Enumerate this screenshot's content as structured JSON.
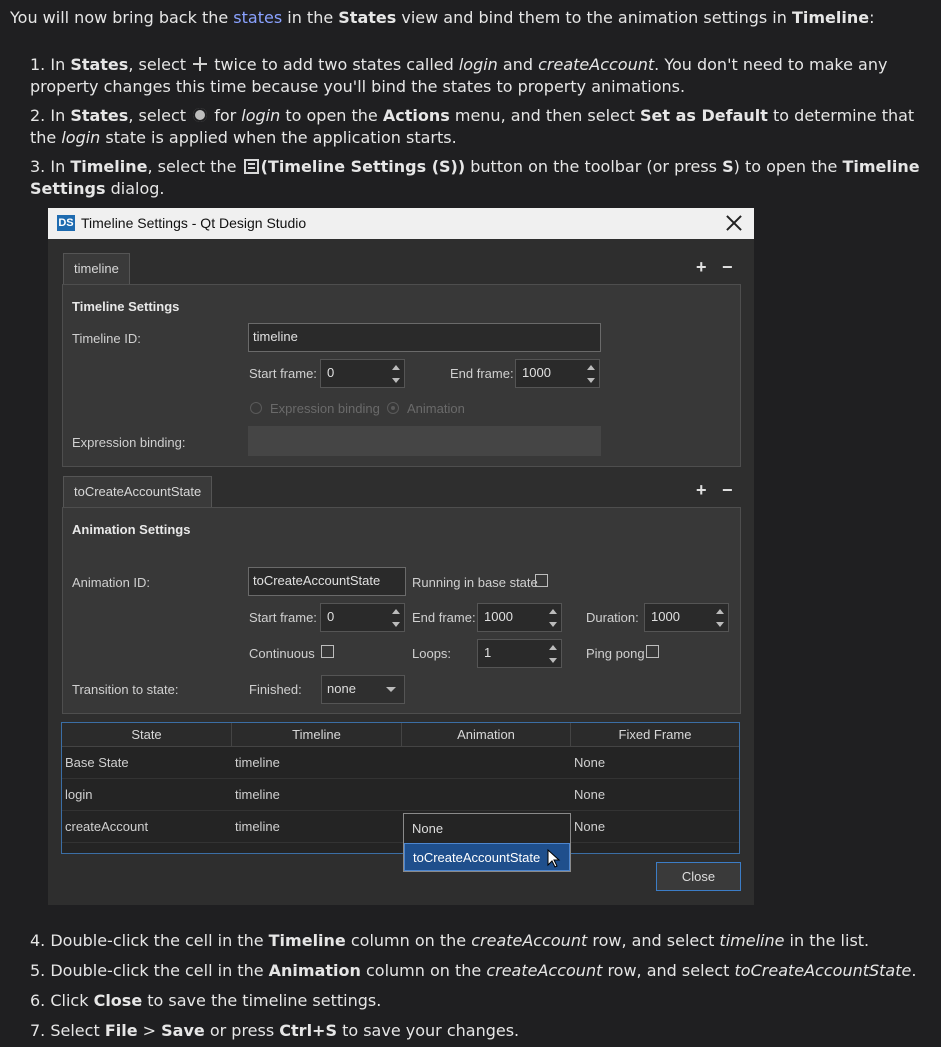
{
  "intro": {
    "t1": "You will now bring back the ",
    "link": "states",
    "t2": " in the ",
    "b1": "States",
    "t3": " view and bind them to the animation settings in ",
    "b2": "Timeline",
    "t4": ":"
  },
  "step1": {
    "n": "1.",
    "a": "In ",
    "b1": "States",
    ",": "",
    "c": ", select ",
    "d": " twice to add two states called ",
    "i1": "login",
    "e": " and ",
    "i2": "createAccount",
    "f": ". You don't need to make any property changes this time because you'll bind the states to property animations."
  },
  "step2": {
    "n": "2.",
    "a": "In ",
    "b1": "States",
    "c": ", select ",
    "d": " for ",
    "i1": "login",
    "e": " to open the ",
    "b2": "Actions",
    "f": " menu, and then select ",
    "b3": "Set as Default",
    "g": " to determine that the ",
    "i2": "login",
    "h": " state is applied when the application starts."
  },
  "step3": {
    "n": "3.",
    "a": "In ",
    "b1": "Timeline",
    "c": ", select the ",
    "b2": "(Timeline Settings (S))",
    "d": " button on the toolbar (or press ",
    "b3": "S",
    "e": ") to open the ",
    "b4": "Timeline Settings",
    "f": " dialog."
  },
  "dialog": {
    "logo": "DS",
    "title": "Timeline Settings - Qt Design Studio",
    "timeline_tab": "timeline",
    "timeline_section": "Timeline Settings",
    "timeline_id_label": "Timeline ID:",
    "timeline_id_value": "timeline",
    "start_frame_label": "Start frame:",
    "start_frame_value": "0",
    "end_frame_label": "End frame:",
    "end_frame_value": "1000",
    "radio_expression": "Expression binding",
    "radio_animation": "Animation",
    "expression_binding_label": "Expression binding:",
    "anim_tab": "toCreateAccountState",
    "anim_section": "Animation Settings",
    "animation_id_label": "Animation ID:",
    "animation_id_value": "toCreateAccountState",
    "running_label": "Running in base state",
    "anim_start_label": "Start frame:",
    "anim_start_value": "0",
    "anim_end_label": "End frame:",
    "anim_end_value": "1000",
    "duration_label": "Duration:",
    "duration_value": "1000",
    "continuous_label": "Continuous",
    "loops_label": "Loops:",
    "loops_value": "1",
    "pingpong_label": "Ping pong",
    "transition_label": "Transition to state:",
    "finished_label": "Finished:",
    "finished_value": "none",
    "plus": "+",
    "minus": "−",
    "table": {
      "headers": [
        "State",
        "Timeline",
        "Animation",
        "Fixed Frame"
      ],
      "rows": [
        [
          "Base State",
          "timeline",
          "",
          "None"
        ],
        [
          "login",
          "timeline",
          "",
          "None"
        ],
        [
          "createAccount",
          "timeline",
          "",
          "None"
        ]
      ]
    },
    "popup": [
      "None",
      "toCreateAccountState"
    ],
    "close_label": "Close"
  },
  "step4": {
    "n": "4.",
    "a": "Double-click the cell in the ",
    "b1": "Timeline",
    "c": " column on the ",
    "i1": "createAccount",
    "d": " row, and select ",
    "i2": "timeline",
    "e": " in the list."
  },
  "step5": {
    "n": "5.",
    "a": "Double-click the cell in the ",
    "b1": "Animation",
    "c": " column on the ",
    "i1": "createAccount",
    "d": " row, and select ",
    "i2": "toCreateAccountState",
    "e": "."
  },
  "step6": {
    "n": "6.",
    "a": "Click ",
    "b1": "Close",
    "c": " to save the timeline settings."
  },
  "step7": {
    "n": "7.",
    "a": "Select ",
    "b1": "File",
    "c": " > ",
    "b2": "Save",
    "d": " or press ",
    "b3": "Ctrl+S",
    "e": " to save your changes."
  }
}
